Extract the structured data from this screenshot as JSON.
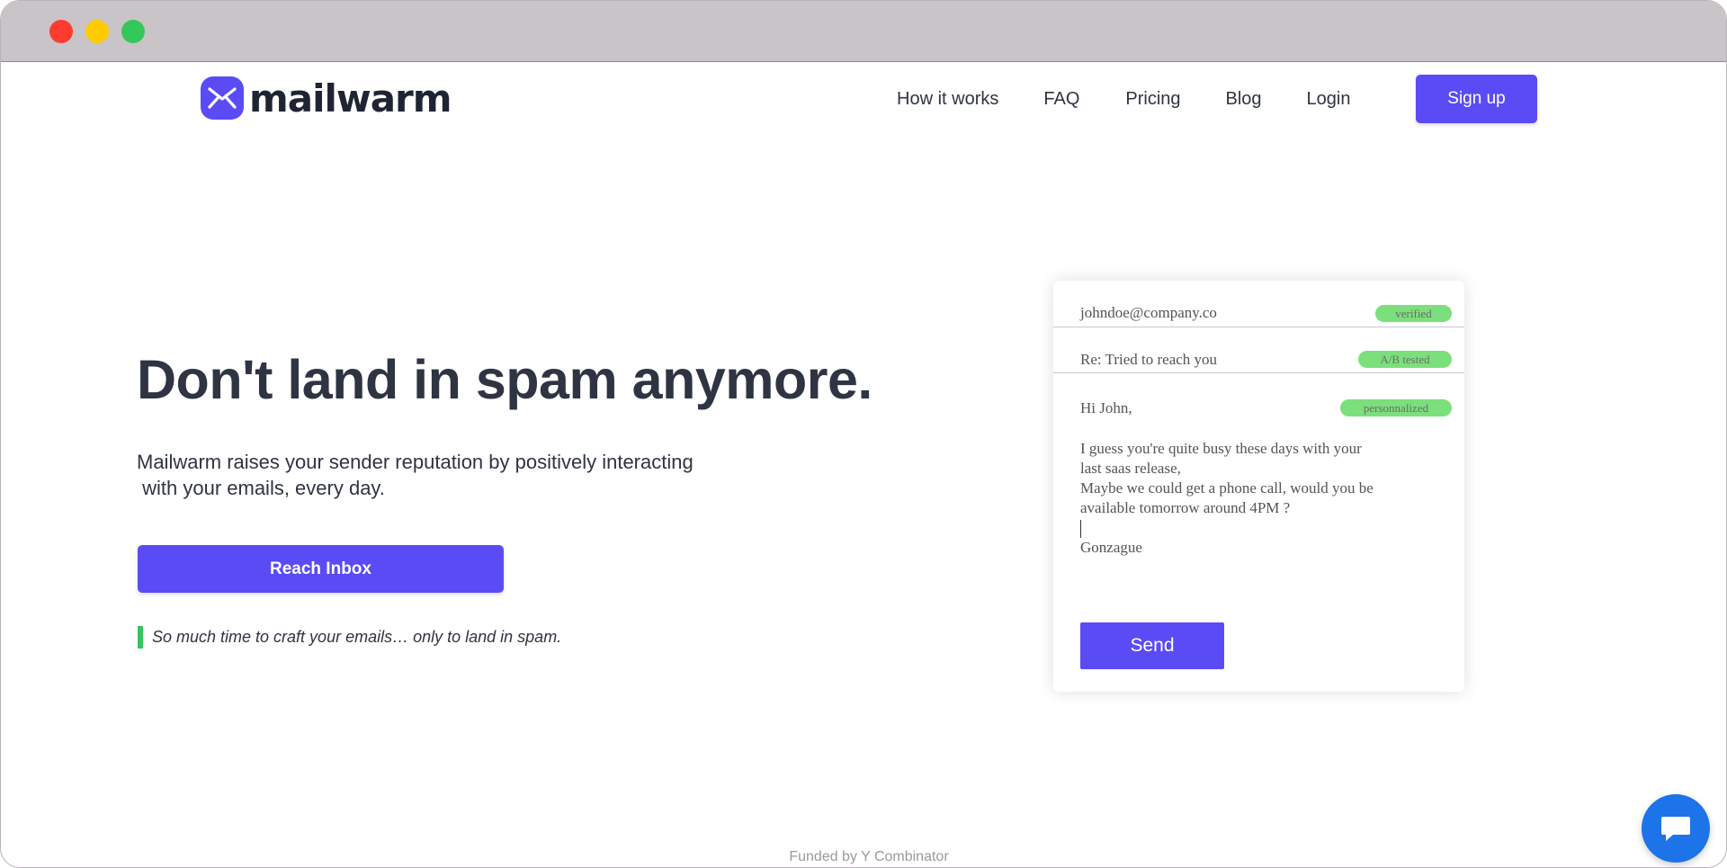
{
  "brand": {
    "name": "mailwarm",
    "color": "#5a4bf5"
  },
  "nav": {
    "links": [
      "How it works",
      "FAQ",
      "Pricing",
      "Blog",
      "Login"
    ],
    "signup_label": "Sign up"
  },
  "hero": {
    "title": "Don't land in spam anymore.",
    "subtitle_lines": [
      "Mailwarm raises your sender reputation by positively interacting",
      " with your emails, every day."
    ],
    "cta_label": "Reach Inbox",
    "quote": "So much time to craft your emails… only to land in spam.",
    "quote_accent": "#37c35e"
  },
  "email_card": {
    "from": "johndoe@company.co",
    "from_badge": "verified",
    "subject": "Re: Tried to reach you",
    "subject_badge": "A/B tested",
    "greeting": "Hi John,",
    "greeting_badge": "personnalized",
    "body_lines": [
      "I guess you're quite busy these days with your",
      "last saas release,",
      "Maybe we could get a phone call, would you be",
      "available tomorrow around 4PM ?"
    ],
    "signature": "Gonzague",
    "send_label": "Send",
    "badge_color": "#7be07c"
  },
  "footer": {
    "note": "Funded by Y Combinator"
  },
  "icons": {
    "logo": "envelope-logo-icon",
    "chat": "chat-bubble-icon"
  }
}
